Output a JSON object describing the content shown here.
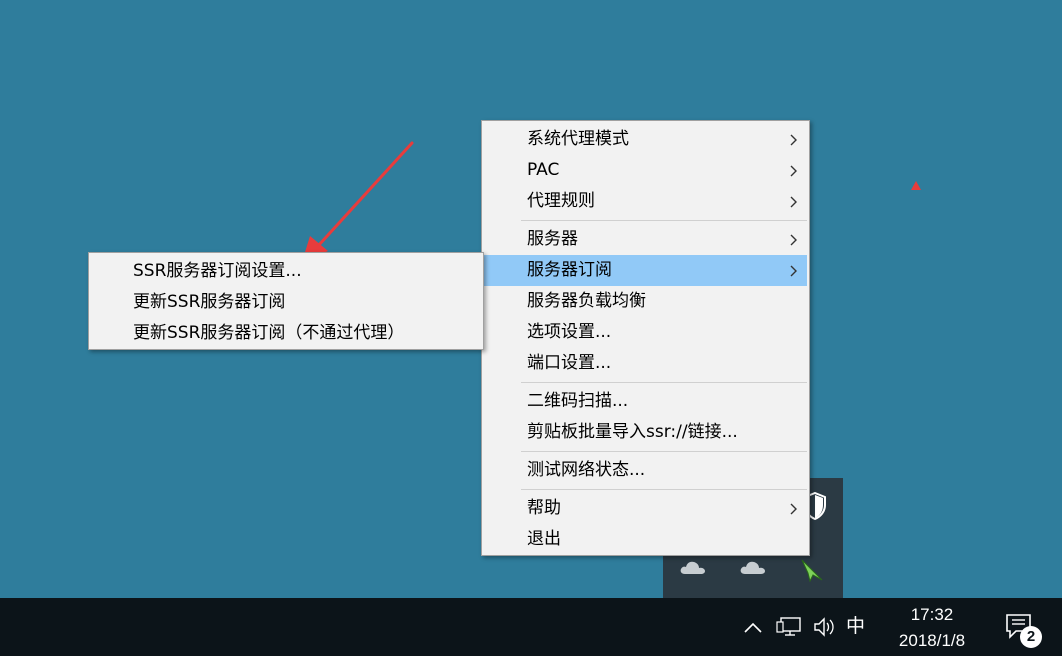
{
  "context_menu": {
    "items": [
      {
        "label": "系统代理模式",
        "submenu": true
      },
      {
        "label": "PAC",
        "submenu": true
      },
      {
        "label": "代理规则",
        "submenu": true
      },
      {
        "label": "服务器",
        "submenu": true
      },
      {
        "label": "服务器订阅",
        "submenu": true,
        "highlighted": true
      },
      {
        "label": "服务器负载均衡",
        "submenu": false
      },
      {
        "label": "选项设置...",
        "submenu": false
      },
      {
        "label": "端口设置...",
        "submenu": false
      },
      {
        "label": "二维码扫描...",
        "submenu": false
      },
      {
        "label": "剪贴板批量导入ssr://链接...",
        "submenu": false
      },
      {
        "label": "测试网络状态...",
        "submenu": false
      },
      {
        "label": "帮助",
        "submenu": true
      },
      {
        "label": "退出",
        "submenu": false
      }
    ]
  },
  "submenu": {
    "items": [
      {
        "label": "SSR服务器订阅设置..."
      },
      {
        "label": "更新SSR服务器订阅"
      },
      {
        "label": "更新SSR服务器订阅（不通过代理）"
      }
    ]
  },
  "tray_flyout": {
    "icons": [
      "shield-icon",
      "onedrive-cloud-icon",
      "onedrive-cloud-icon",
      "ssr-paper-plane-icon"
    ]
  },
  "taskbar": {
    "ime": "中",
    "time": "17:32",
    "date": "2018/1/8",
    "notification_count": "2"
  },
  "colors": {
    "desktop": "#2f7d9c",
    "menu_background": "#f2f2f2",
    "menu_highlight": "#91c9f7",
    "taskbar": "#0c1419",
    "annotation_arrow": "#e83c3c"
  }
}
